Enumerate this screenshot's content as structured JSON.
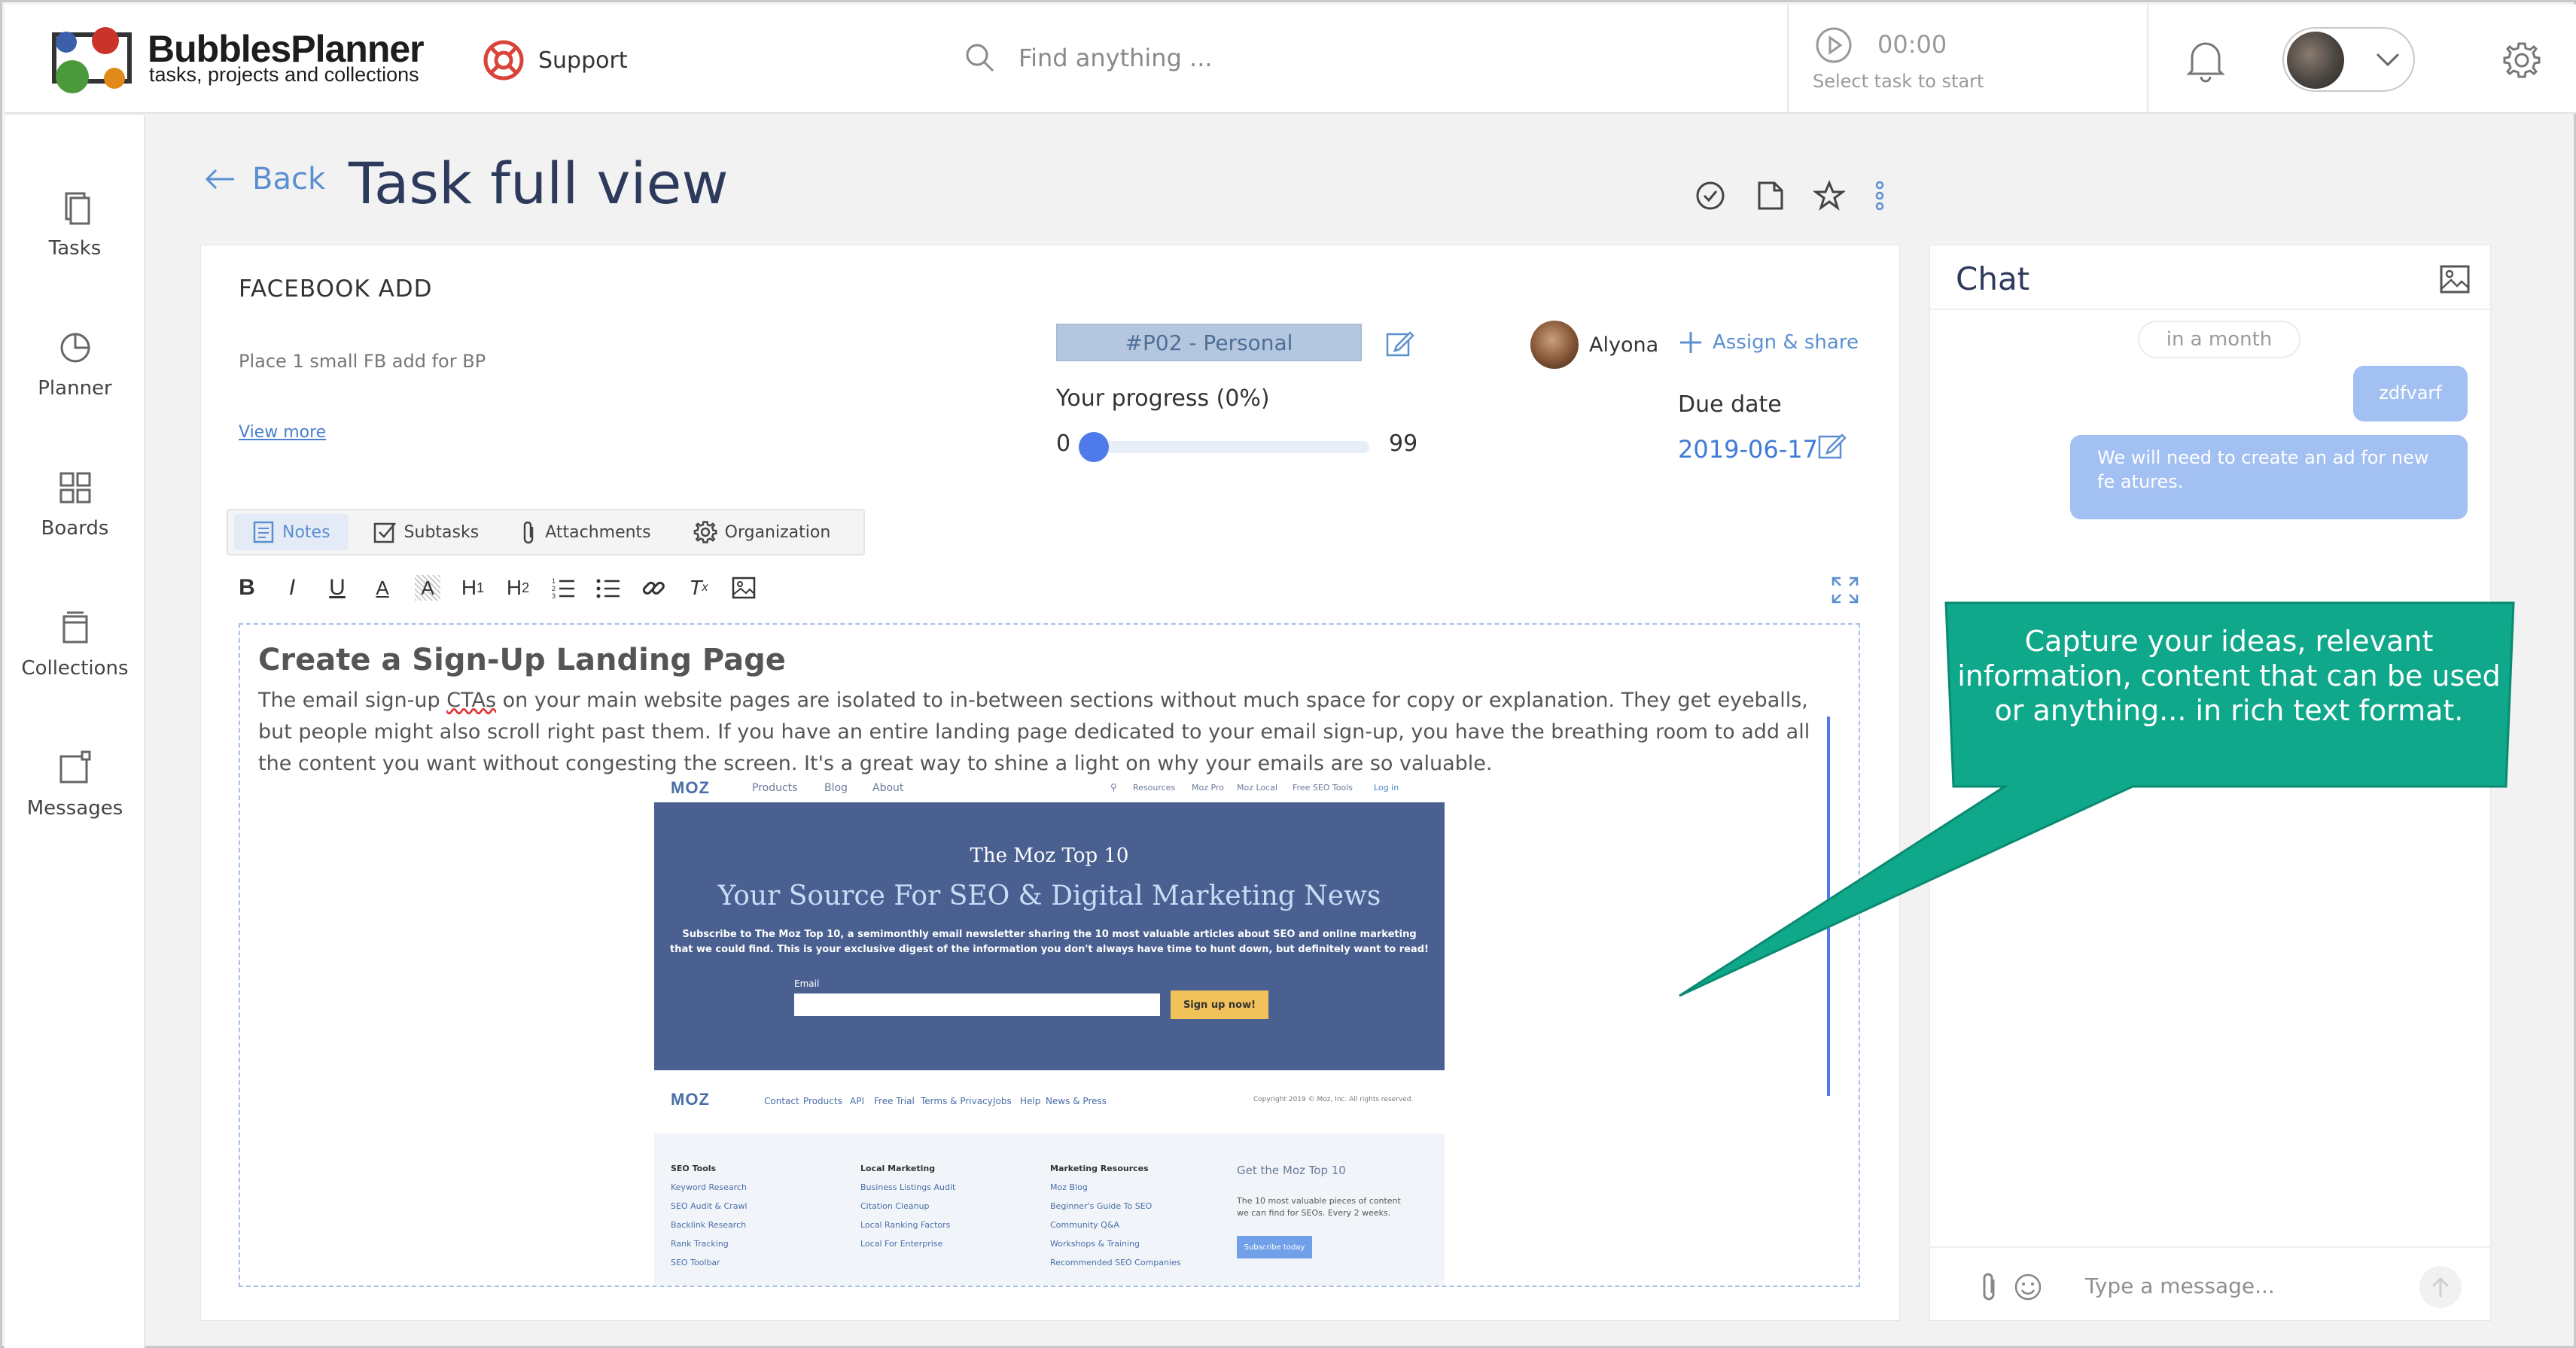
{
  "header": {
    "brand": "BubblesPlanner",
    "tagline": "tasks, projects and collections",
    "support_label": "Support",
    "search_placeholder": "Find anything ...",
    "timer_time": "00:00",
    "timer_hint": "Select task to start"
  },
  "sidebar": {
    "items": [
      {
        "label": "Tasks",
        "icon": "tasks-icon"
      },
      {
        "label": "Planner",
        "icon": "planner-icon"
      },
      {
        "label": "Boards",
        "icon": "boards-icon"
      },
      {
        "label": "Collections",
        "icon": "collections-icon"
      },
      {
        "label": "Messages",
        "icon": "messages-icon"
      }
    ]
  },
  "page": {
    "back_label": "Back",
    "title": "Task full view"
  },
  "task": {
    "name": "FACEBOOK ADD",
    "description": "Place 1 small FB add for BP",
    "view_more": "View more",
    "project_tag": "#P02 - Personal",
    "assignee": "Alyona",
    "assign_share": "Assign & share",
    "progress_label": "Your progress  (0%)",
    "progress_min": "0",
    "progress_max": "99",
    "progress_value": 0,
    "due_label": "Due date",
    "due_value": "2019-06-17"
  },
  "tabs": [
    {
      "label": "Notes",
      "active": true
    },
    {
      "label": "Subtasks",
      "active": false
    },
    {
      "label": "Attachments",
      "active": false
    },
    {
      "label": "Organization",
      "active": false
    }
  ],
  "editor": {
    "heading": "Create a Sign-Up Landing Page",
    "text_before": "The email sign-up ",
    "text_spell": "CTAs",
    "text_after": " on your main website pages are isolated to in-between sections without much space for copy or explanation. They get eyeballs, but people might also scroll right past them. If you have an entire landing page dedicated to your email sign-up, you have the breathing room to add all the content you want without congesting the screen. It's a great way to shine a light on why your emails are so valuable."
  },
  "embedded_image": {
    "logo": "MOZ",
    "nav": [
      "Products",
      "Blog",
      "About"
    ],
    "nav_right": [
      "Resources",
      "Moz Pro",
      "Moz Local",
      "Free SEO Tools",
      "Log in"
    ],
    "hero_title": "The Moz Top 10",
    "hero_subtitle": "Your Source For SEO & Digital Marketing News",
    "hero_text": "Subscribe to The Moz Top 10, a semimonthly email newsletter sharing the 10 most valuable articles about SEO and online marketing that we could find. This is your exclusive digest of the information you don't always have time to hunt down, but definitely want to read!",
    "email_label": "Email",
    "signup_button": "Sign up now!",
    "footer_nav": [
      "Contact",
      "Products",
      "API",
      "Free Trial",
      "Terms & Privacy",
      "Jobs",
      "Help",
      "News & Press"
    ],
    "copyright": "Copyright 2019 © Moz, Inc. All rights reserved.",
    "col1": {
      "title": "SEO Tools",
      "links": [
        "Keyword Research",
        "SEO Audit & Crawl",
        "Backlink Research",
        "Rank Tracking",
        "SEO Toolbar"
      ]
    },
    "col2": {
      "title": "Local Marketing",
      "links": [
        "Business Listings Audit",
        "Citation Cleanup",
        "Local Ranking Factors",
        "Local For Enterprise"
      ]
    },
    "col3": {
      "title": "Marketing Resources",
      "links": [
        "Moz Blog",
        "Beginner's Guide To SEO",
        "Community Q&A",
        "Workshops & Training",
        "Recommended SEO Companies"
      ]
    },
    "newsletter_title": "Get the Moz Top 10",
    "newsletter_text": "The 10 most valuable pieces of content we can find for SEOs. Every 2 weeks.",
    "newsletter_button": "Subscribe today"
  },
  "chat": {
    "title": "Chat",
    "date_chip": "in a month",
    "messages": [
      {
        "text": "zdfvarf"
      },
      {
        "text": "We will need to create an ad for new fe atures."
      }
    ],
    "input_placeholder": "Type a message..."
  },
  "callout": {
    "text": "Capture your ideas, relevant information, content that can be used or anything... in rich text format.",
    "color": "#0fa88a"
  },
  "colors": {
    "accent": "#5b8fd1",
    "title": "#2e3a5c",
    "bubble": "#a3c0f2",
    "tag_bg": "#b4c7de"
  }
}
